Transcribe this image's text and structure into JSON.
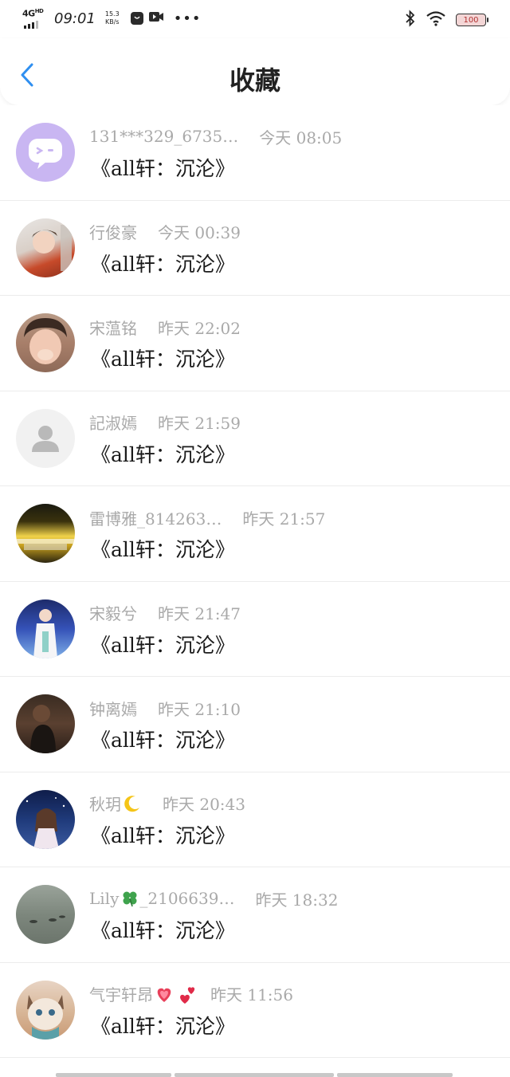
{
  "status_bar": {
    "network": "4G",
    "network_sup": "HD",
    "time": "09:01",
    "speed_value": "15.3",
    "speed_unit": "KB/s",
    "more": "•••",
    "battery": "100"
  },
  "header": {
    "title": "收藏"
  },
  "items": [
    {
      "user": "131***329_6735…",
      "time": "今天 08:05",
      "title": "《all轩：沉沦》",
      "emoji": ""
    },
    {
      "user": "行俊豪",
      "time": "今天 00:39",
      "title": "《all轩：沉沦》",
      "emoji": ""
    },
    {
      "user": "宋蕰铭",
      "time": "昨天 22:02",
      "title": "《all轩：沉沦》",
      "emoji": ""
    },
    {
      "user": "記淑嫣",
      "time": "昨天 21:59",
      "title": "《all轩：沉沦》",
      "emoji": ""
    },
    {
      "user": "雷博雅_814263…",
      "time": "昨天 21:57",
      "title": "《all轩：沉沦》",
      "emoji": ""
    },
    {
      "user": "宋毅兮",
      "time": "昨天 21:47",
      "title": "《all轩：沉沦》",
      "emoji": ""
    },
    {
      "user": "钟离嫣",
      "time": "昨天 21:10",
      "title": "《all轩：沉沦》",
      "emoji": ""
    },
    {
      "user": "秋玥",
      "time": "昨天 20:43",
      "title": "《all轩：沉沦》",
      "emoji": "moon-icon"
    },
    {
      "user": "Lily",
      "user_suffix": "_2106639…",
      "time": "昨天 18:32",
      "title": "《all轩：沉沦》",
      "emoji": "clover-icon"
    },
    {
      "user": "气宇轩昂",
      "time": "昨天 11:56",
      "title": "《all轩：沉沦》",
      "emoji": "hearts-icon"
    }
  ],
  "colors": {
    "accent": "#2f8ff0",
    "meta_text": "#a9a9a9",
    "title_text": "#1a1a1a"
  }
}
